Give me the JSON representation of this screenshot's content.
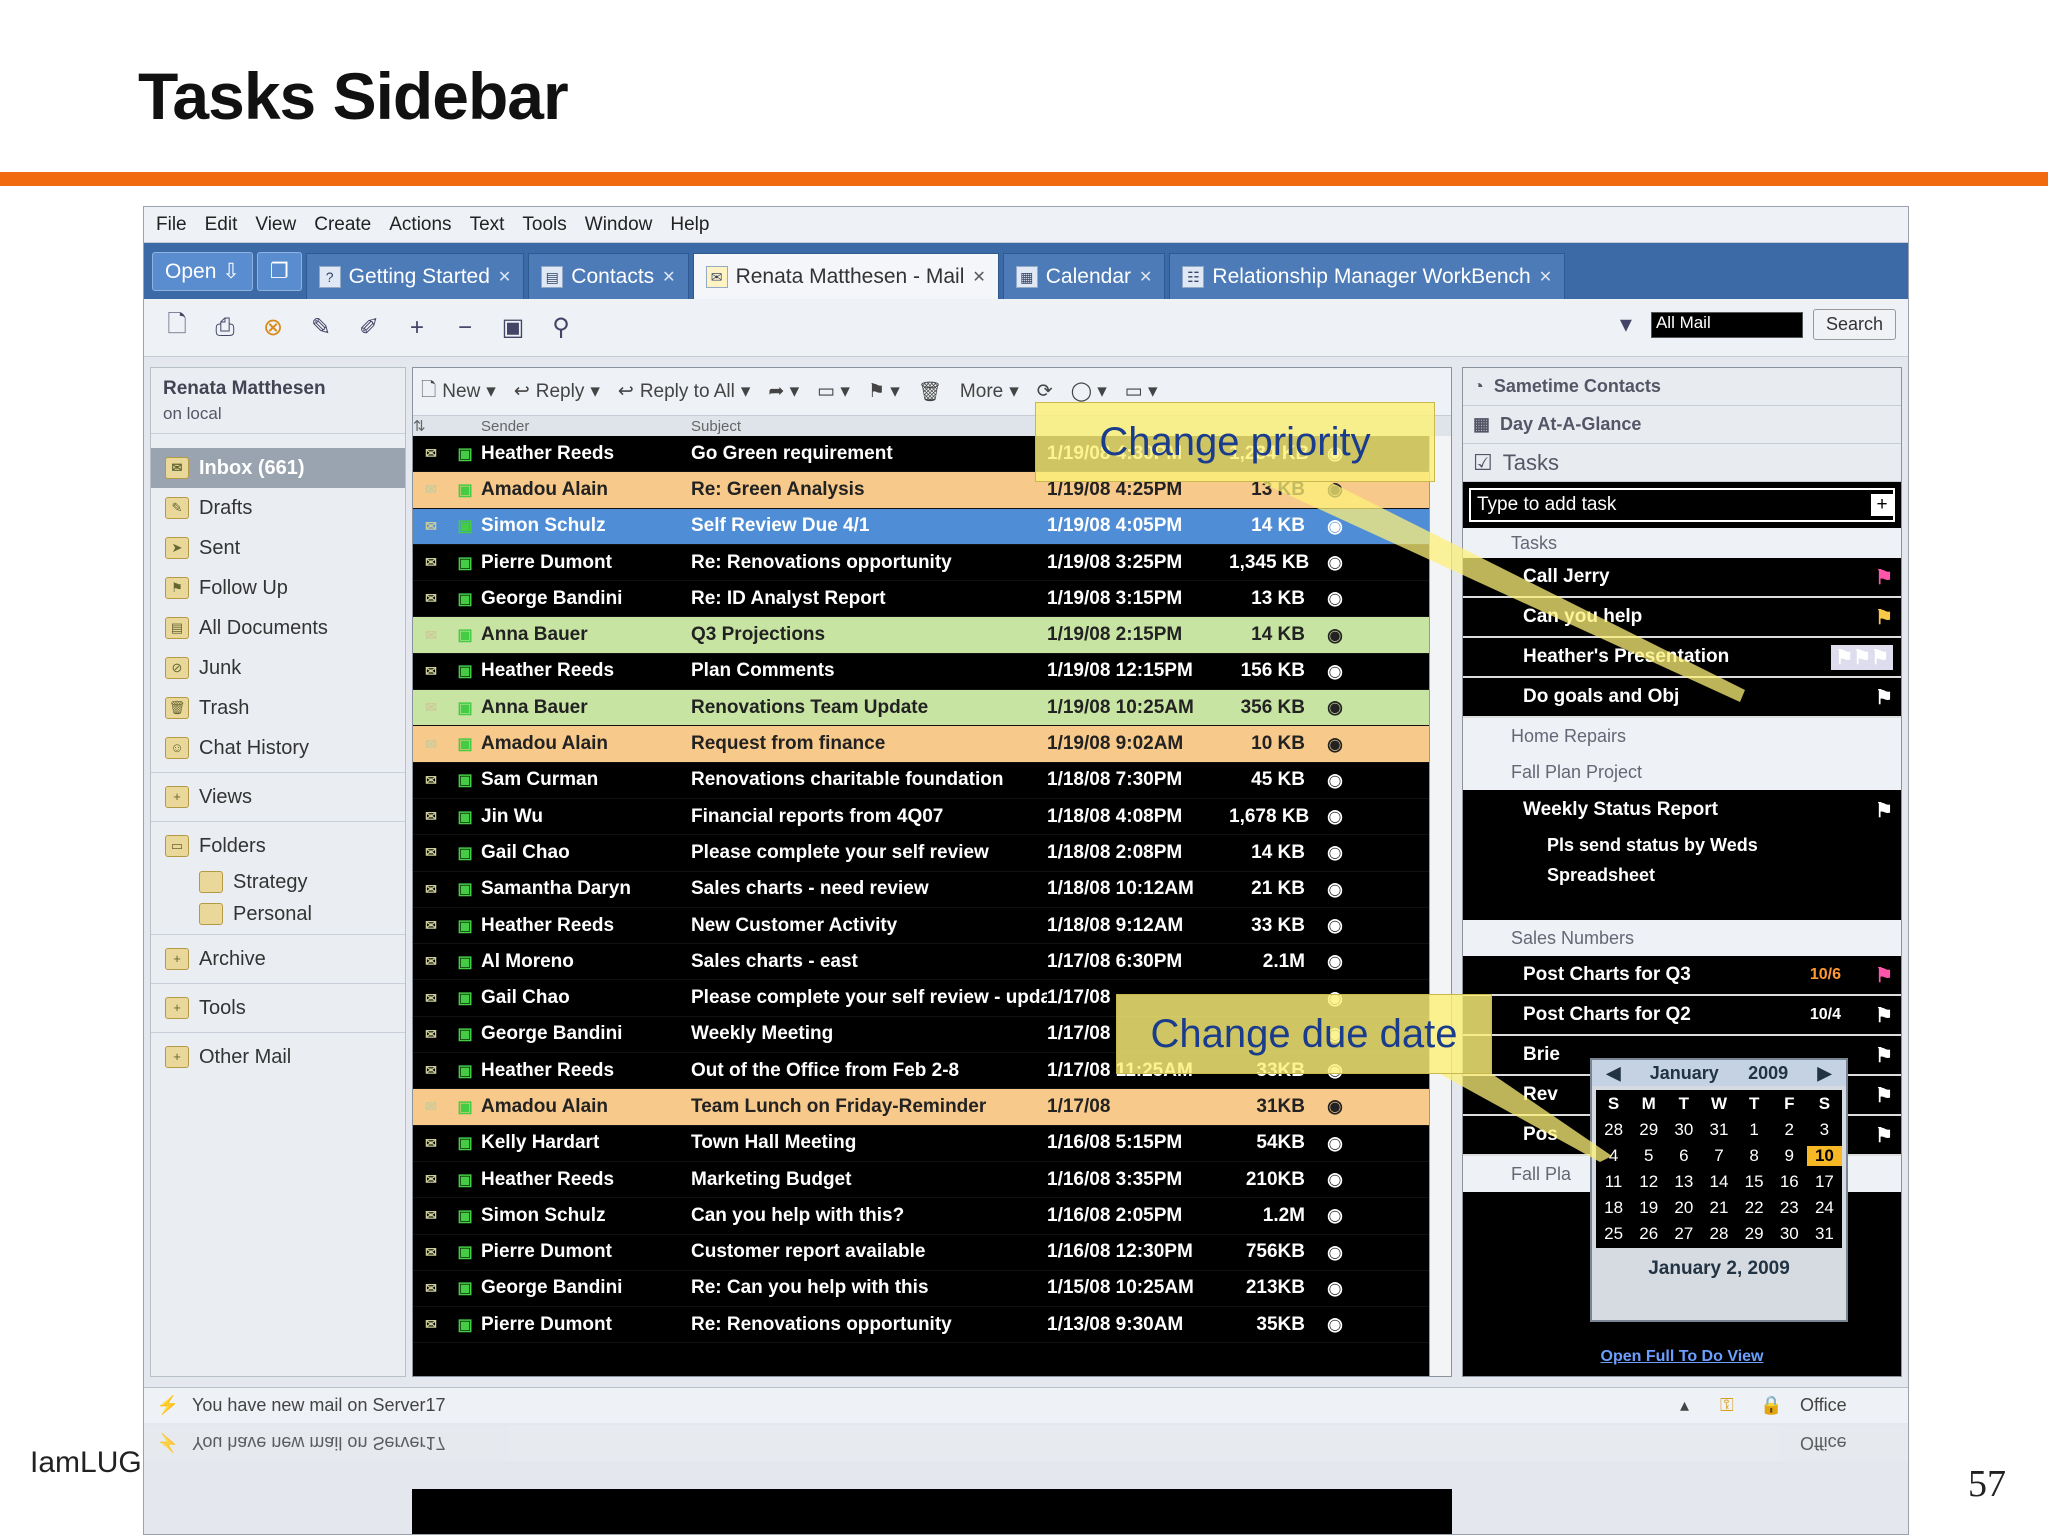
{
  "slide": {
    "title": "Tasks Sidebar",
    "footer": "IamLUG",
    "page_number": "57"
  },
  "menu": [
    "File",
    "Edit",
    "View",
    "Create",
    "Actions",
    "Text",
    "Tools",
    "Window",
    "Help"
  ],
  "tabs": {
    "open": "Open",
    "items": [
      "Getting Started",
      "Contacts",
      "Renata Matthesen - Mail",
      "Calendar",
      "Relationship Manager WorkBench"
    ]
  },
  "search": {
    "scope": "All Mail",
    "button": "Search"
  },
  "nav": {
    "user": "Renata Matthesen",
    "location": "on local",
    "items": [
      "Inbox (661)",
      "Drafts",
      "Sent",
      "Follow Up",
      "All Documents",
      "Junk",
      "Trash",
      "Chat History"
    ],
    "views": "Views",
    "folders": "Folders",
    "folder_items": [
      "Strategy",
      "Personal"
    ],
    "archive": "Archive",
    "tools": "Tools",
    "other_mail": "Other Mail"
  },
  "mail_toolbar": {
    "new": "New",
    "reply": "Reply",
    "reply_all": "Reply to All",
    "more": "More"
  },
  "columns": {
    "sender": "Sender",
    "subject": "Subject"
  },
  "messages": [
    {
      "sender": "Heather Reeds",
      "subject": "Go Green requirement",
      "date": "1/19/08 4:30PM",
      "size": "1,234 KB",
      "style": "k"
    },
    {
      "sender": "Amadou Alain",
      "subject": "Re: Green Analysis",
      "date": "1/19/08 4:25PM",
      "size": "13 KB",
      "style": "o"
    },
    {
      "sender": "Simon Schulz",
      "subject": "Self Review Due 4/1",
      "date": "1/19/08 4:05PM",
      "size": "14 KB",
      "style": "b"
    },
    {
      "sender": "Pierre Dumont",
      "subject": "Re: Renovations opportunity",
      "date": "1/19/08 3:25PM",
      "size": "1,345 KB",
      "style": "k"
    },
    {
      "sender": "George Bandini",
      "subject": "Re: ID Analyst Report",
      "date": "1/19/08 3:15PM",
      "size": "13 KB",
      "style": "k"
    },
    {
      "sender": "Anna Bauer",
      "subject": "Q3 Projections",
      "date": "1/19/08 2:15PM",
      "size": "14 KB",
      "style": "g"
    },
    {
      "sender": "Heather Reeds",
      "subject": "Plan Comments",
      "date": "1/19/08 12:15PM",
      "size": "156 KB",
      "style": "k"
    },
    {
      "sender": "Anna Bauer",
      "subject": "Renovations Team Update",
      "date": "1/19/08 10:25AM",
      "size": "356 KB",
      "style": "g"
    },
    {
      "sender": "Amadou Alain",
      "subject": "Request from finance",
      "date": "1/19/08 9:02AM",
      "size": "10 KB",
      "style": "o"
    },
    {
      "sender": "Sam Curman",
      "subject": "Renovations charitable foundation",
      "date": "1/18/08 7:30PM",
      "size": "45 KB",
      "style": "k"
    },
    {
      "sender": "Jin Wu",
      "subject": "Financial reports from 4Q07",
      "date": "1/18/08 4:08PM",
      "size": "1,678 KB",
      "style": "k"
    },
    {
      "sender": "Gail Chao",
      "subject": "Please complete your self review",
      "date": "1/18/08 2:08PM",
      "size": "14 KB",
      "style": "k"
    },
    {
      "sender": "Samantha Daryn",
      "subject": "Sales charts - need review",
      "date": "1/18/08 10:12AM",
      "size": "21 KB",
      "style": "k"
    },
    {
      "sender": "Heather Reeds",
      "subject": "New Customer Activity",
      "date": "1/18/08 9:12AM",
      "size": "33 KB",
      "style": "k"
    },
    {
      "sender": "Al Moreno",
      "subject": "Sales charts - east",
      "date": "1/17/08 6:30PM",
      "size": "2.1M",
      "style": "k"
    },
    {
      "sender": "Gail Chao",
      "subject": "Please complete your self review - update",
      "date": "1/17/08",
      "size": "",
      "style": "k"
    },
    {
      "sender": "George Bandini",
      "subject": "Weekly Meeting",
      "date": "1/17/08",
      "size": "",
      "style": "k"
    },
    {
      "sender": "Heather Reeds",
      "subject": "Out of the Office from Feb 2-8",
      "date": "1/17/08 11:25AM",
      "size": "33KB",
      "style": "k"
    },
    {
      "sender": "Amadou Alain",
      "subject": "Team Lunch on Friday-Reminder",
      "date": "1/17/08",
      "size": "31KB",
      "style": "o"
    },
    {
      "sender": "Kelly Hardart",
      "subject": "Town Hall Meeting",
      "date": "1/16/08 5:15PM",
      "size": "54KB",
      "style": "k"
    },
    {
      "sender": "Heather Reeds",
      "subject": "Marketing Budget",
      "date": "1/16/08 3:35PM",
      "size": "210KB",
      "style": "k"
    },
    {
      "sender": "Simon Schulz",
      "subject": "Can you help with this?",
      "date": "1/16/08 2:05PM",
      "size": "1.2M",
      "style": "k"
    },
    {
      "sender": "Pierre Dumont",
      "subject": "Customer report available",
      "date": "1/16/08 12:30PM",
      "size": "756KB",
      "style": "k"
    },
    {
      "sender": "George Bandini",
      "subject": "Re: Can you help with this",
      "date": "1/15/08 10:25AM",
      "size": "213KB",
      "style": "k"
    },
    {
      "sender": "Pierre Dumont",
      "subject": "Re: Renovations opportunity",
      "date": "1/13/08 9:30AM",
      "size": "35KB",
      "style": "k"
    }
  ],
  "sidebar": {
    "sametime": "Sametime Contacts",
    "day": "Day At-A-Glance",
    "tasks": "Tasks",
    "add_placeholder": "Type to add task",
    "group_tasks": "Tasks",
    "tasks_items": [
      "Call Jerry",
      "Can you help",
      "Heather's Presentation",
      "Do goals and Obj"
    ],
    "home_repairs": "Home Repairs",
    "fall_plan": "Fall Plan Project",
    "weekly": "Weekly Status Report",
    "weekly_sub": [
      "Pls send status by Weds",
      "Spreadsheet"
    ],
    "sales_numbers": "Sales Numbers",
    "sales_items": [
      "Post Charts for Q3",
      "Post Charts for Q2",
      "Brie",
      "Rev",
      "Pos"
    ],
    "sales_dates": [
      "10/6",
      "10/4"
    ],
    "fall_plan_2": "Fall Pla",
    "open_full": "Open Full To Do View"
  },
  "calendar": {
    "month": "January",
    "year": "2009",
    "days_header": [
      "S",
      "M",
      "T",
      "W",
      "T",
      "F",
      "S"
    ],
    "weeks": [
      [
        "28",
        "29",
        "30",
        "31",
        "1",
        "2",
        "3"
      ],
      [
        "4",
        "5",
        "6",
        "7",
        "8",
        "9",
        "10"
      ],
      [
        "11",
        "12",
        "13",
        "14",
        "15",
        "16",
        "17"
      ],
      [
        "18",
        "19",
        "20",
        "21",
        "22",
        "23",
        "24"
      ],
      [
        "25",
        "26",
        "27",
        "28",
        "29",
        "30",
        "31"
      ]
    ],
    "today": "10",
    "footer": "January 2, 2009"
  },
  "callouts": {
    "priority": "Change priority",
    "due_date": "Change due date"
  },
  "status": {
    "message": "You have new mail on Server17",
    "location": "Office"
  }
}
